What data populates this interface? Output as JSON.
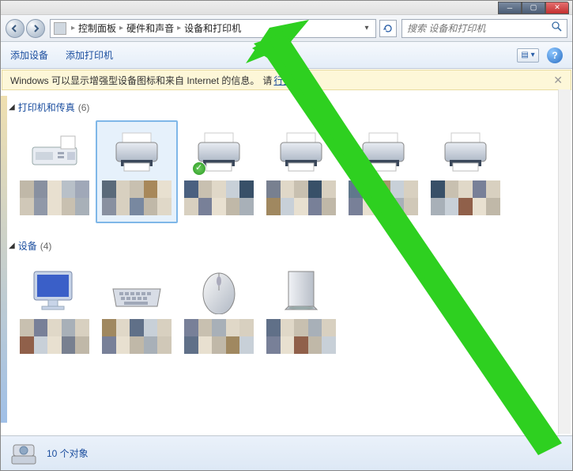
{
  "breadcrumb": [
    {
      "icon": true
    },
    {
      "label": "控制面板"
    },
    {
      "label": "硬件和声音"
    },
    {
      "label": "设备和打印机"
    }
  ],
  "search": {
    "placeholder": "搜索 设备和打印机"
  },
  "toolbar": {
    "add_device": "添加设备",
    "add_printer": "添加打印机"
  },
  "infobar": {
    "text_prefix": "Windows 可以显示增强型设备图标和来自 Internet 的信息。",
    "link": "行更改..."
  },
  "sections": {
    "printers": {
      "title": "打印机和传真",
      "count": "(6)"
    },
    "devices": {
      "title": "设备",
      "count": "(4)"
    }
  },
  "statusbar": {
    "text": "10 个对象"
  },
  "pixel_palettes": {
    "a": [
      "#c0b8a8",
      "#8890a0",
      "#e8e0d0",
      "#b8c0c8",
      "#a0a8b8",
      "#d0c8b8",
      "#9098a8",
      "#e8e0d0",
      "#c8c0b0",
      "#a8b0b8"
    ],
    "b": [
      "#5a6a7a",
      "#d8d0c0",
      "#c8c0b0",
      "#a8885a",
      "#e8e0d0",
      "#8890a0",
      "#d8d0c0",
      "#7888a0",
      "#c0b8a8",
      "#e0d8c8"
    ],
    "c": [
      "#4a6080",
      "#c8c0b0",
      "#e0d8c8",
      "#c8d0d8",
      "#385068",
      "#d8d0c0",
      "#788098",
      "#e8e0d0",
      "#c0b8a8",
      "#a8b0b8"
    ],
    "d": [
      "#788090",
      "#e0d8c8",
      "#c8c0b0",
      "#385068",
      "#d8d0c0",
      "#a08860",
      "#c8d0d8",
      "#e8e0d0",
      "#788098",
      "#c0b8a8"
    ],
    "e": [
      "#60788c",
      "#e0d8c8",
      "#a89870",
      "#c8d0d8",
      "#d8d0c0",
      "#788098",
      "#e8e0d0",
      "#c0b8a8",
      "#a8b0b8",
      "#d0c8b8"
    ],
    "f": [
      "#385068",
      "#c8c0b0",
      "#e0d8c8",
      "#788098",
      "#d8d0c0",
      "#a8b0b8",
      "#c8d0d8",
      "#90604a",
      "#e8e0d0",
      "#c0b8a8"
    ],
    "g": [
      "#c8c0b0",
      "#788098",
      "#e0d8c8",
      "#a8b0b8",
      "#d8d0c0",
      "#90604a",
      "#c8d0d8",
      "#e8e0d0",
      "#788090",
      "#c0b8a8"
    ],
    "h": [
      "#a08860",
      "#e0d8c8",
      "#607088",
      "#c8d0d8",
      "#d8d0c0",
      "#788098",
      "#e8e0d0",
      "#c0b8a8",
      "#a8b0b8",
      "#d0c8b8"
    ],
    "i": [
      "#788098",
      "#c8c0b0",
      "#a8b0b8",
      "#e0d8c8",
      "#d8d0c0",
      "#607088",
      "#e8e0d0",
      "#c0b8a8",
      "#a08860",
      "#c8d0d8"
    ],
    "j": [
      "#607088",
      "#e0d8c8",
      "#c8c0b0",
      "#a8b0b8",
      "#d8d0c0",
      "#788098",
      "#e8e0d0",
      "#90604a",
      "#c0b8a8",
      "#c8d0d8"
    ]
  }
}
